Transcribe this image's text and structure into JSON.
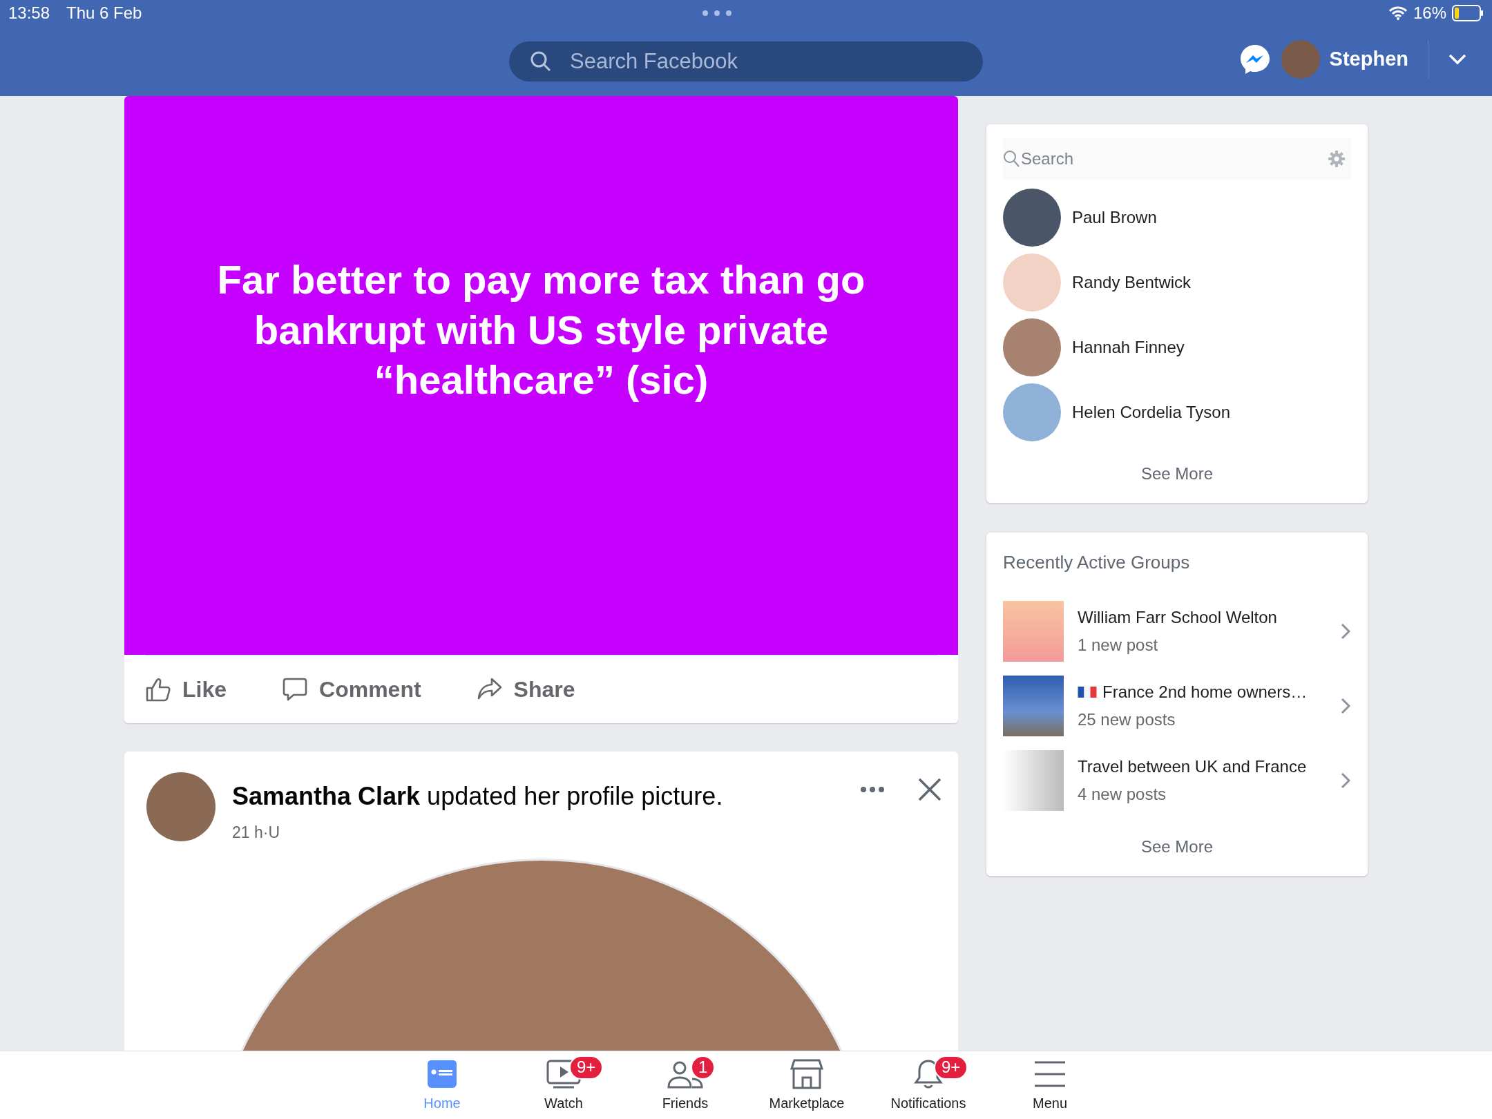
{
  "status_bar": {
    "time": "13:58",
    "date": "Thu 6 Feb",
    "battery": "16%"
  },
  "top_bar": {
    "search": {
      "placeholder": "Search Facebook"
    },
    "user": "Stephen"
  },
  "feed": [
    {
      "kind": "text_post",
      "text": "Far better to pay more tax than go bankrupt with US style private “healthcare” (sic)",
      "actions": [
        "Like",
        "Comment",
        "Share"
      ]
    },
    {
      "kind": "profile_update",
      "headline": "**Samantha Clark** updated her profile picture.",
      "meta": "21 h·U"
    }
  ],
  "contacts": {
    "search": {
      "placeholder": "Search"
    },
    "items": [
      {
        "name": "Paul Brown"
      },
      {
        "name": "Randy Bentwick"
      },
      {
        "name": "Hannah Finney"
      },
      {
        "name": "Helen Cordelia Tyson"
      }
    ],
    "see_more": "See More"
  },
  "groups": {
    "title": "Recently Active Groups",
    "items": [
      {
        "name": "William Farr School Welton",
        "flag": false,
        "activity": "1 new post"
      },
      {
        "name": "France 2nd home owners…",
        "flag": true,
        "activity": "25 new posts"
      },
      {
        "name": "Travel between UK and France",
        "flag": false,
        "activity": "4 new posts"
      }
    ],
    "see_more": "See More"
  },
  "bottom_nav": [
    {
      "label": "Home",
      "kind": "home",
      "selected": true
    },
    {
      "label": "Watch",
      "kind": "watch",
      "badge": "9+",
      "selected": false
    },
    {
      "label": "Friends",
      "kind": "friends",
      "badge": "1",
      "selected": false
    },
    {
      "label": "Marketplace",
      "kind": "market",
      "selected": false
    },
    {
      "label": "Notifications",
      "kind": "bell",
      "badge": "9+",
      "selected": false
    },
    {
      "label": "Menu",
      "kind": "menu",
      "selected": false
    }
  ]
}
